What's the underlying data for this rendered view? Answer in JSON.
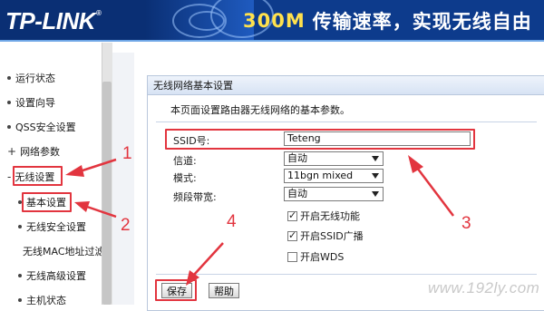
{
  "header": {
    "logo": "TP-LINK",
    "logo_mark": "®",
    "banner_highlight": "300M",
    "banner_text": "传输速率，实现无线自由"
  },
  "sidebar": {
    "items": [
      {
        "label": "运行状态",
        "type": "main"
      },
      {
        "label": "设置向导",
        "type": "main"
      },
      {
        "label": "QSS安全设置",
        "type": "main"
      },
      {
        "label": "网络参数",
        "type": "main",
        "prefix": "+"
      },
      {
        "label": "无线设置",
        "type": "main",
        "prefix": "-"
      },
      {
        "label": "基本设置",
        "type": "sub"
      },
      {
        "label": "无线安全设置",
        "type": "sub"
      },
      {
        "label": "无线MAC地址过滤",
        "type": "sub"
      },
      {
        "label": "无线高级设置",
        "type": "sub"
      },
      {
        "label": "主机状态",
        "type": "sub"
      }
    ]
  },
  "panel": {
    "title": "无线网络基本设置",
    "intro": "本页面设置路由器无线网络的基本参数。",
    "fields": {
      "ssid_label": "SSID号:",
      "ssid_value": "Teteng",
      "channel_label": "信道:",
      "channel_value": "自动",
      "mode_label": "模式:",
      "mode_value": "11bgn mixed",
      "bandwidth_label": "频段带宽:",
      "bandwidth_value": "自动"
    },
    "checkboxes": [
      {
        "label": "开启无线功能",
        "checked": true
      },
      {
        "label": "开启SSID广播",
        "checked": true
      },
      {
        "label": "开启WDS",
        "checked": false
      }
    ],
    "buttons": {
      "save": "保存",
      "help": "帮助"
    }
  },
  "annotations": {
    "n1": "1",
    "n2": "2",
    "n3": "3",
    "n4": "4",
    "color": "#e2353f"
  },
  "watermark": "www.192ly.com"
}
